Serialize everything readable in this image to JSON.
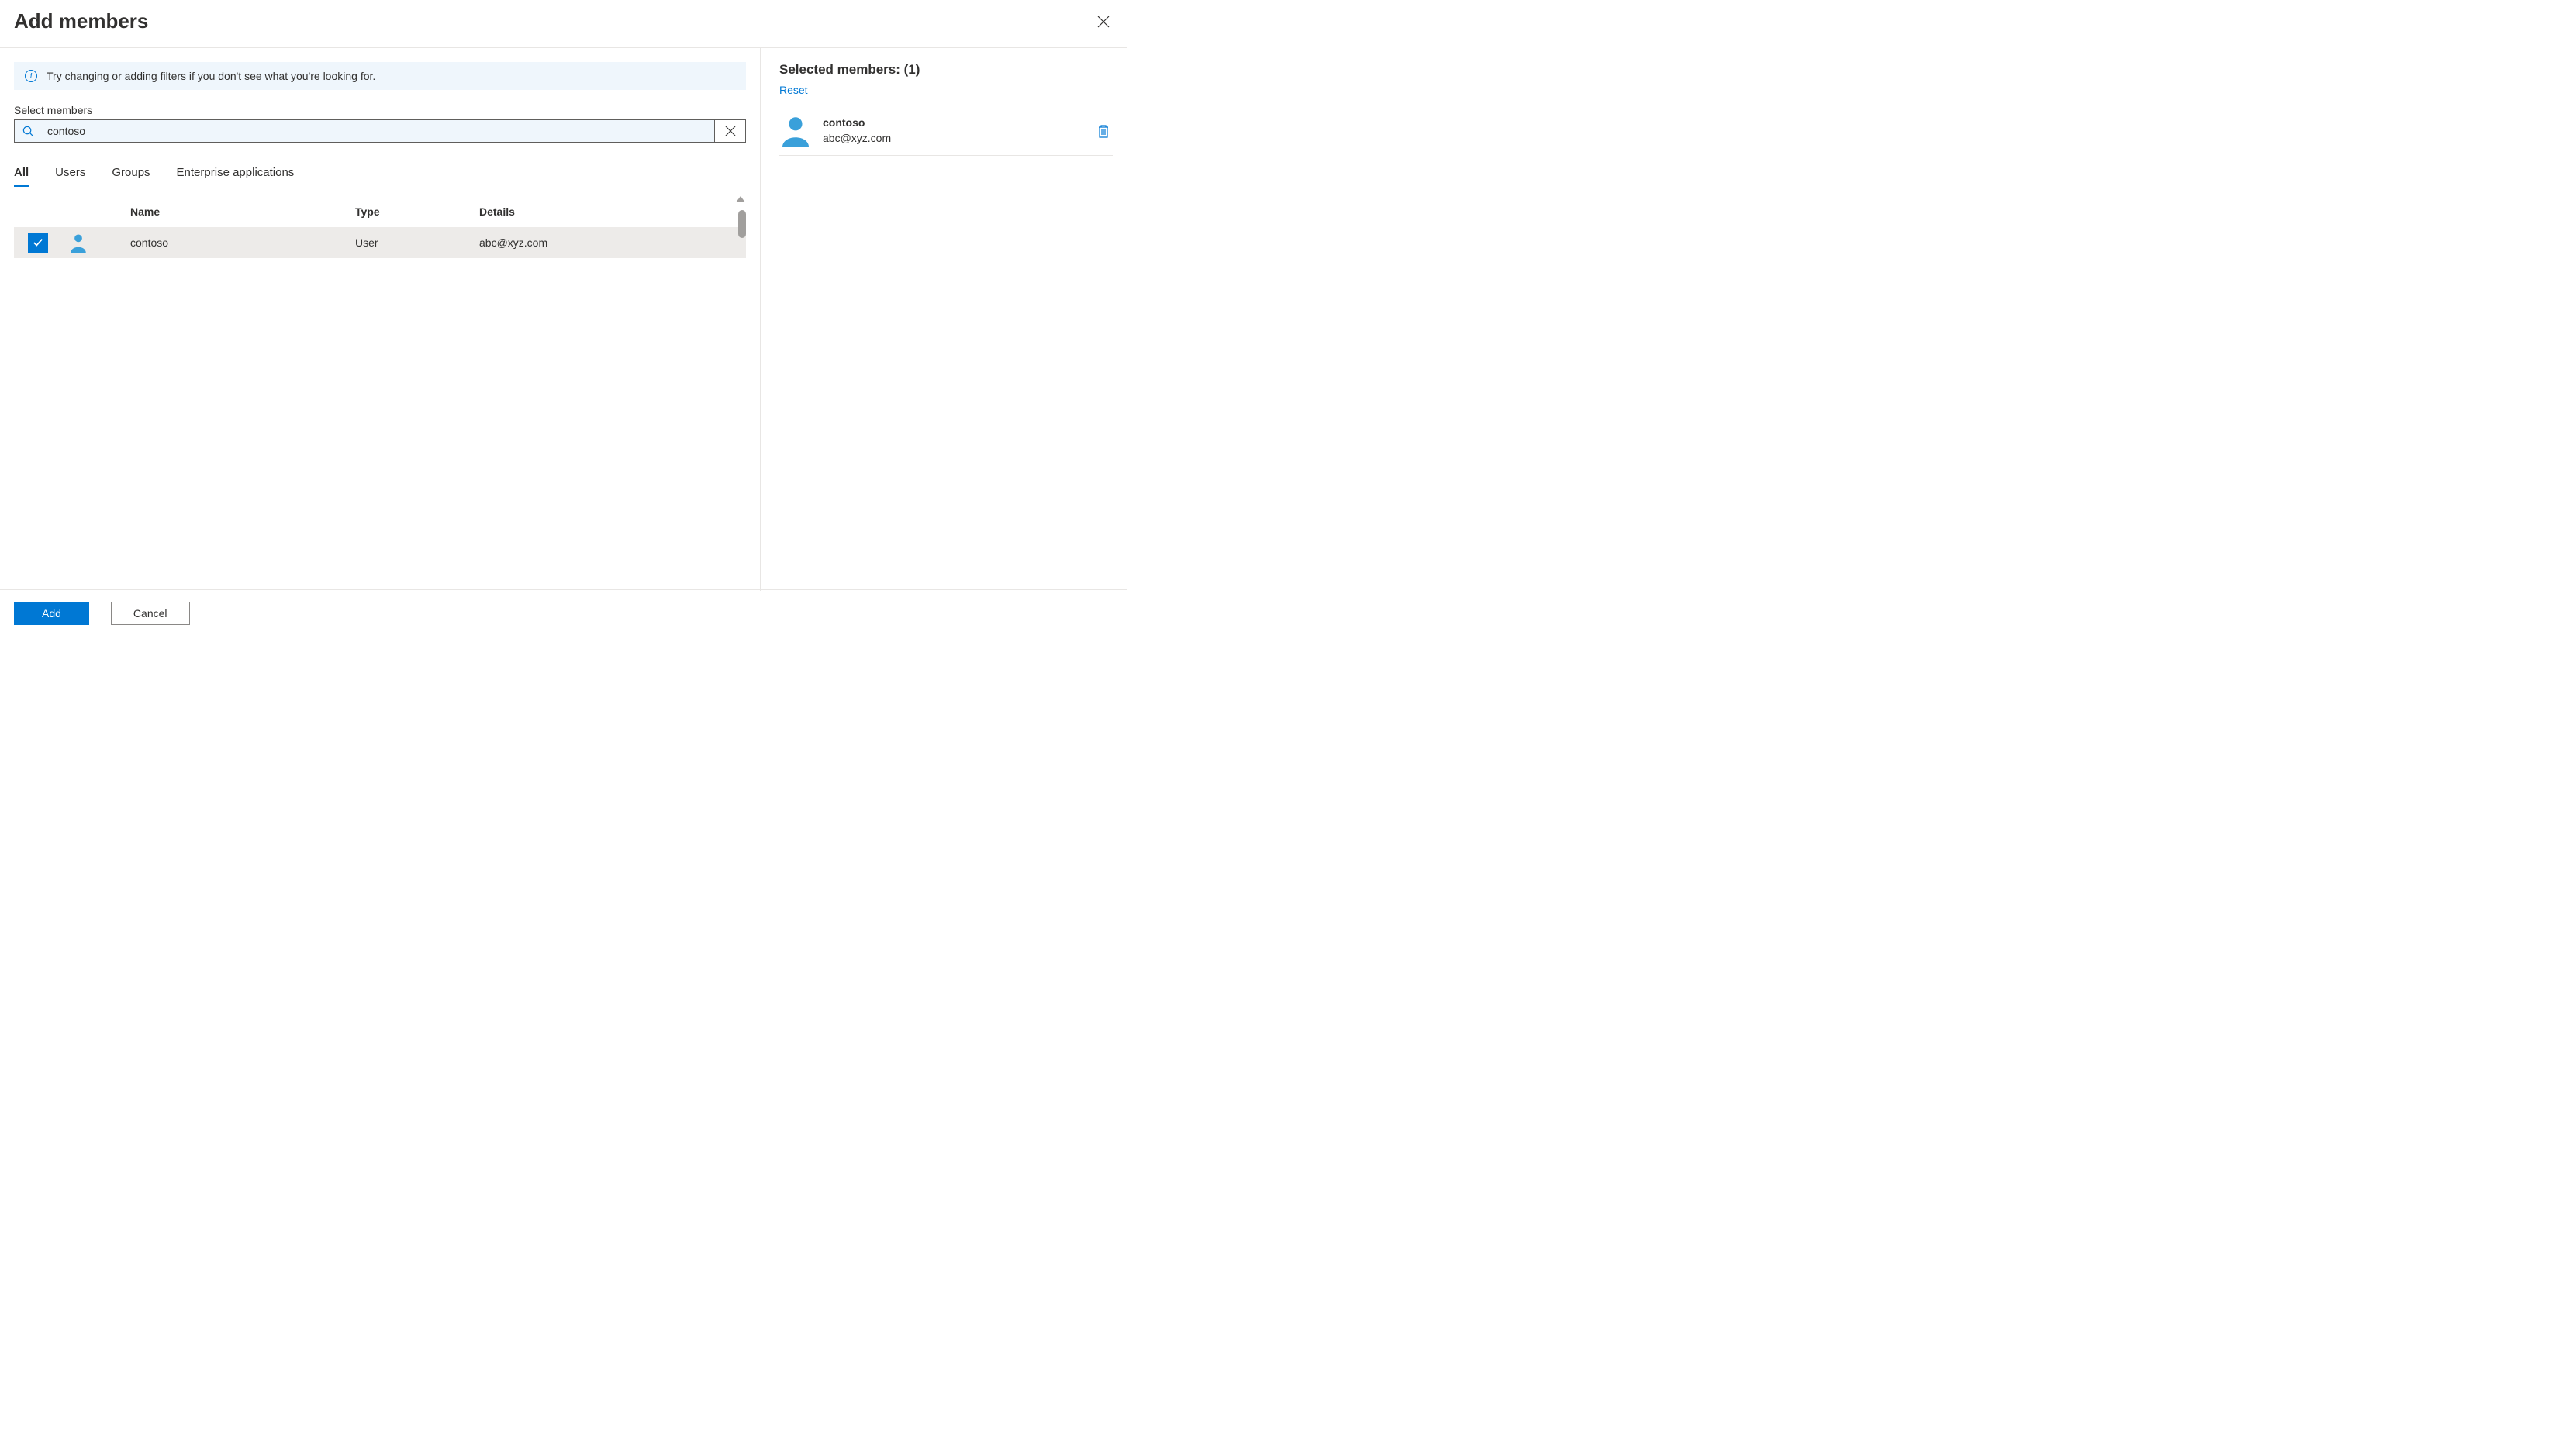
{
  "header": {
    "title": "Add members"
  },
  "info": {
    "text": "Try changing or adding filters if you don't see what you're looking for."
  },
  "search": {
    "label": "Select members",
    "value": "contoso"
  },
  "tabs": [
    {
      "label": "All",
      "active": true
    },
    {
      "label": "Users",
      "active": false
    },
    {
      "label": "Groups",
      "active": false
    },
    {
      "label": "Enterprise applications",
      "active": false
    }
  ],
  "columns": {
    "name": "Name",
    "type": "Type",
    "details": "Details"
  },
  "results": [
    {
      "name": "contoso",
      "type": "User",
      "details": "abc@xyz.com",
      "selected": true
    }
  ],
  "selected": {
    "title_prefix": "Selected members: ",
    "count_display": "(1)",
    "reset_label": "Reset",
    "items": [
      {
        "name": "contoso",
        "detail": "abc@xyz.com"
      }
    ]
  },
  "footer": {
    "add": "Add",
    "cancel": "Cancel"
  }
}
